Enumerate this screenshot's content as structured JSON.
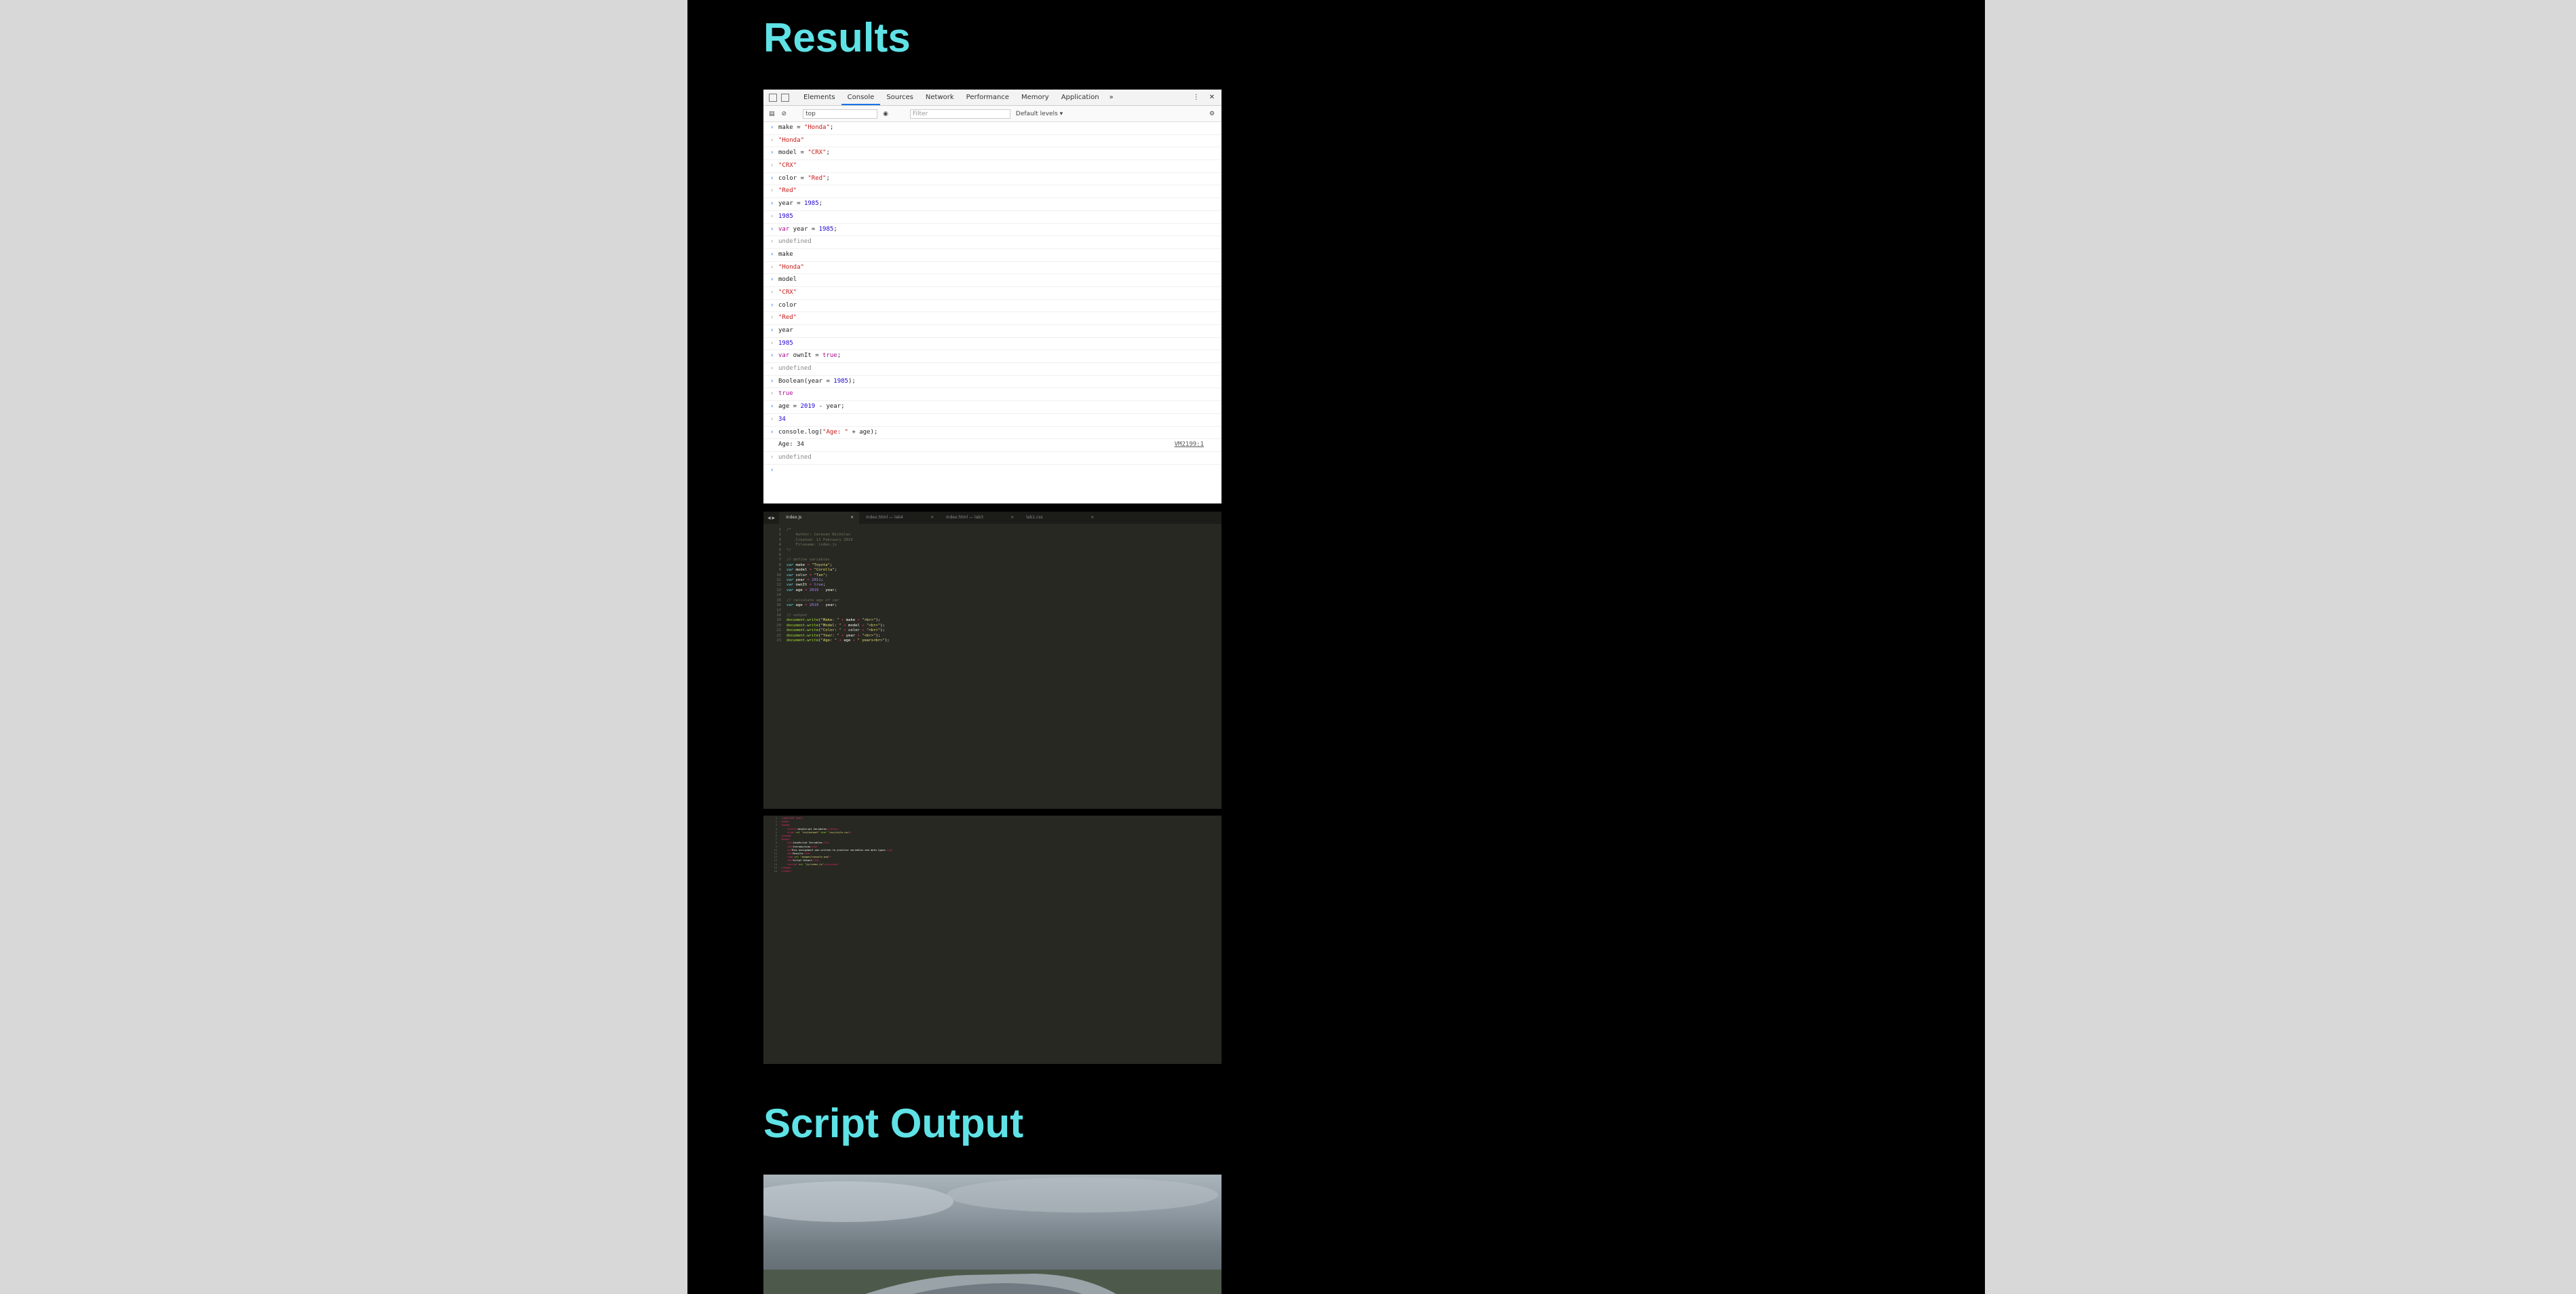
{
  "headings": {
    "results": "Results",
    "script_output": "Script Output"
  },
  "devtools": {
    "tabs": [
      "Elements",
      "Console",
      "Sources",
      "Network",
      "Performance",
      "Memory",
      "Application"
    ],
    "more": "»",
    "context": "top",
    "filter_placeholder": "Filter",
    "levels": "Default levels ▾",
    "source_link": "VM2199:1"
  },
  "editor1": {
    "tabs": [
      "index.js",
      "index.html — lab4",
      "index.html — lab3",
      "lab1.css",
      ""
    ],
    "close": "×"
  },
  "colors": {
    "heading": "#5fe2e6",
    "editor_bg": "#272822"
  }
}
